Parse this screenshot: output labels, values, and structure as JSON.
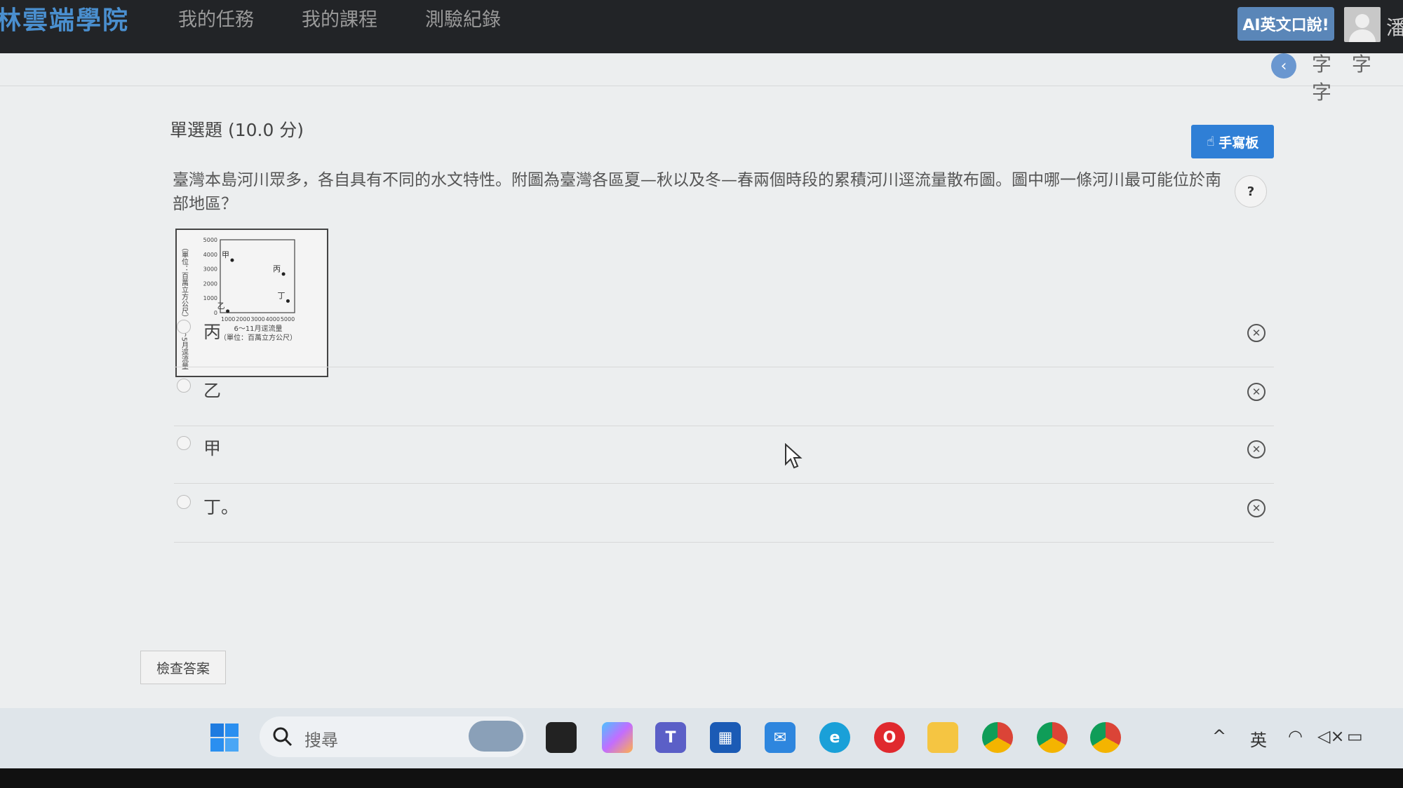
{
  "header": {
    "brand": "林雲端學院",
    "nav": [
      "我的任務",
      "我的課程",
      "測驗紀錄"
    ],
    "ai_badge": "AI英文口說!",
    "user_name": "潘"
  },
  "toolbar": {
    "font_sizes": "字 字 字"
  },
  "question": {
    "type": "單選題 (10.0 分)",
    "pad_button": "手寫板",
    "help": "?",
    "text": "臺灣本島河川眾多，各自具有不同的水文特性。附圖為臺灣各區夏—秋以及冬—春兩個時段的累積河川逕流量散布圖。圖中哪一條河川最可能位於南部地區？"
  },
  "chart_data": {
    "type": "scatter",
    "xlabel": "6～11月逕流量",
    "xunit": "（單位：百萬立方公尺）",
    "ylabel": "（單位：百萬立方公尺）12～5月逕流量",
    "xlim": [
      0,
      5000
    ],
    "ylim": [
      0,
      5000
    ],
    "x_ticks": [
      "1000",
      "2000",
      "3000",
      "4000",
      "5000"
    ],
    "y_ticks": [
      "0",
      "1000",
      "2000",
      "3000",
      "4000",
      "5000"
    ],
    "points": [
      {
        "label": "甲",
        "x": 800,
        "y": 3600
      },
      {
        "label": "丙",
        "x": 4250,
        "y": 2650
      },
      {
        "label": "乙",
        "x": 500,
        "y": 100
      },
      {
        "label": "丁",
        "x": 4550,
        "y": 800
      }
    ]
  },
  "options": [
    {
      "label": "丙"
    },
    {
      "label": "乙"
    },
    {
      "label": "甲"
    },
    {
      "label": "丁。"
    }
  ],
  "check_button": "檢查答案",
  "taskbar": {
    "search_placeholder": "搜尋",
    "ime": "英"
  }
}
